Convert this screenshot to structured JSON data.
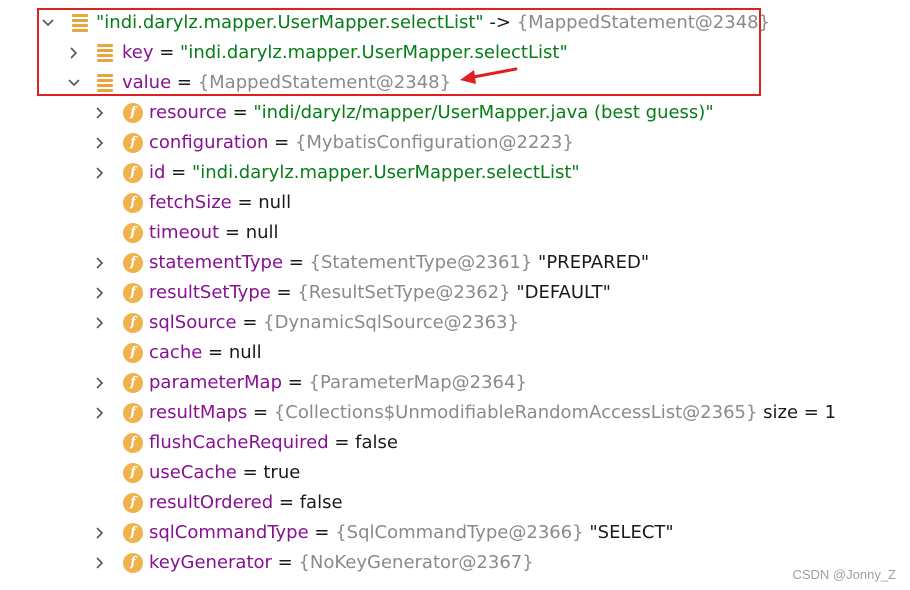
{
  "tree": {
    "root": {
      "key_text": "\"indi.darylz.mapper.UserMapper.selectList\"",
      "arrow": " -> ",
      "value_text": "{MappedStatement@2348}"
    },
    "key_row": {
      "name": "key",
      "eq": " = ",
      "value": "\"indi.darylz.mapper.UserMapper.selectList\""
    },
    "value_row": {
      "name": "value",
      "eq": " = ",
      "value": "{MappedStatement@2348}"
    },
    "fields": [
      {
        "name": "resource",
        "eq": " = ",
        "value": "\"indi/darylz/mapper/UserMapper.java (best guess)\"",
        "kind": "str",
        "expandable": true
      },
      {
        "name": "configuration",
        "eq": " = ",
        "value": "{MybatisConfiguration@2223}",
        "kind": "obj",
        "expandable": true
      },
      {
        "name": "id",
        "eq": " = ",
        "value": "\"indi.darylz.mapper.UserMapper.selectList\"",
        "kind": "str",
        "expandable": true
      },
      {
        "name": "fetchSize",
        "eq": " = ",
        "value": "null",
        "kind": "plain",
        "expandable": false
      },
      {
        "name": "timeout",
        "eq": " = ",
        "value": "null",
        "kind": "plain",
        "expandable": false
      },
      {
        "name": "statementType",
        "eq": " = ",
        "value": "{StatementType@2361}",
        "kind": "obj",
        "extra": " \"PREPARED\"",
        "expandable": true
      },
      {
        "name": "resultSetType",
        "eq": " = ",
        "value": "{ResultSetType@2362}",
        "kind": "obj",
        "extra": " \"DEFAULT\"",
        "expandable": true
      },
      {
        "name": "sqlSource",
        "eq": " = ",
        "value": "{DynamicSqlSource@2363}",
        "kind": "obj",
        "expandable": true
      },
      {
        "name": "cache",
        "eq": " = ",
        "value": "null",
        "kind": "plain",
        "expandable": false
      },
      {
        "name": "parameterMap",
        "eq": " = ",
        "value": "{ParameterMap@2364}",
        "kind": "obj",
        "expandable": true
      },
      {
        "name": "resultMaps",
        "eq": " = ",
        "value": "{Collections$UnmodifiableRandomAccessList@2365}",
        "kind": "obj",
        "extra": "  size = 1",
        "expandable": true
      },
      {
        "name": "flushCacheRequired",
        "eq": " = ",
        "value": "false",
        "kind": "plain",
        "expandable": false
      },
      {
        "name": "useCache",
        "eq": " = ",
        "value": "true",
        "kind": "plain",
        "expandable": false
      },
      {
        "name": "resultOrdered",
        "eq": " = ",
        "value": "false",
        "kind": "plain",
        "expandable": false
      },
      {
        "name": "sqlCommandType",
        "eq": " = ",
        "value": "{SqlCommandType@2366}",
        "kind": "obj",
        "extra": " \"SELECT\"",
        "expandable": true
      },
      {
        "name": "keyGenerator",
        "eq": " = ",
        "value": "{NoKeyGenerator@2367}",
        "kind": "obj",
        "expandable": true
      }
    ]
  },
  "watermark": "CSDN @Jonny_Z",
  "colors": {
    "field_name": "#871094",
    "string_value": "#067d17",
    "object_value": "#8a8a8a",
    "highlight": "#e02020",
    "field_icon": "#f0b24a"
  }
}
